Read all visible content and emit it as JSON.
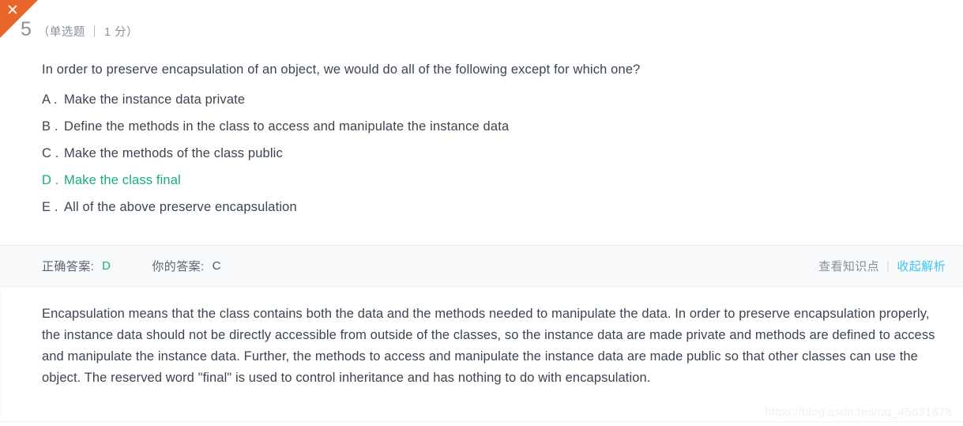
{
  "card": {
    "status_marker": {
      "icon": "close-icon",
      "glyph": "✕",
      "color": "#e8662a",
      "meaning": "incorrect"
    },
    "number": "5",
    "meta": "（单选题 ｜ 1 分）",
    "stem": "In order to preserve encapsulation of an object, we would do all of the following except for which one?"
  },
  "options": [
    {
      "letter": "A .",
      "text": "Make the instance data private",
      "correct": false
    },
    {
      "letter": "B .",
      "text": "Define the methods in the class to access and manipulate the instance data",
      "correct": false
    },
    {
      "letter": "C .",
      "text": "Make the methods of the class public",
      "correct": false
    },
    {
      "letter": "D .",
      "text": "Make the class final",
      "correct": true
    },
    {
      "letter": "E .",
      "text": "All of the above preserve encapsulation",
      "correct": false
    }
  ],
  "answer_bar": {
    "correct_label": "正确答案:",
    "correct_value": "D",
    "your_label": "你的答案:",
    "your_value": "C",
    "knowledge_link": "查看知识点",
    "separator": "|",
    "toggle_link": "收起解析"
  },
  "analysis": {
    "text": "Encapsulation means that the class contains both the data and the methods needed to manipulate the data.  In order to preserve encapsulation properly, the instance data should not be directly accessible from outside of the classes, so the instance data are made private and methods are defined to access and manipulate the instance data.  Further, the methods to access and manipulate the instance data are made public so that other classes can use the object.  The reserved word \"final\" is used to control inheritance and has nothing to do with encapsulation."
  },
  "watermark": "https://blog.csdn.net/qq_45631878",
  "colors": {
    "correct_green": "#18ad7e",
    "ribbon_orange": "#e8662a",
    "link_blue": "#41c5ef",
    "text_dark": "#3b4552",
    "bar_background": "#f9fafb"
  }
}
